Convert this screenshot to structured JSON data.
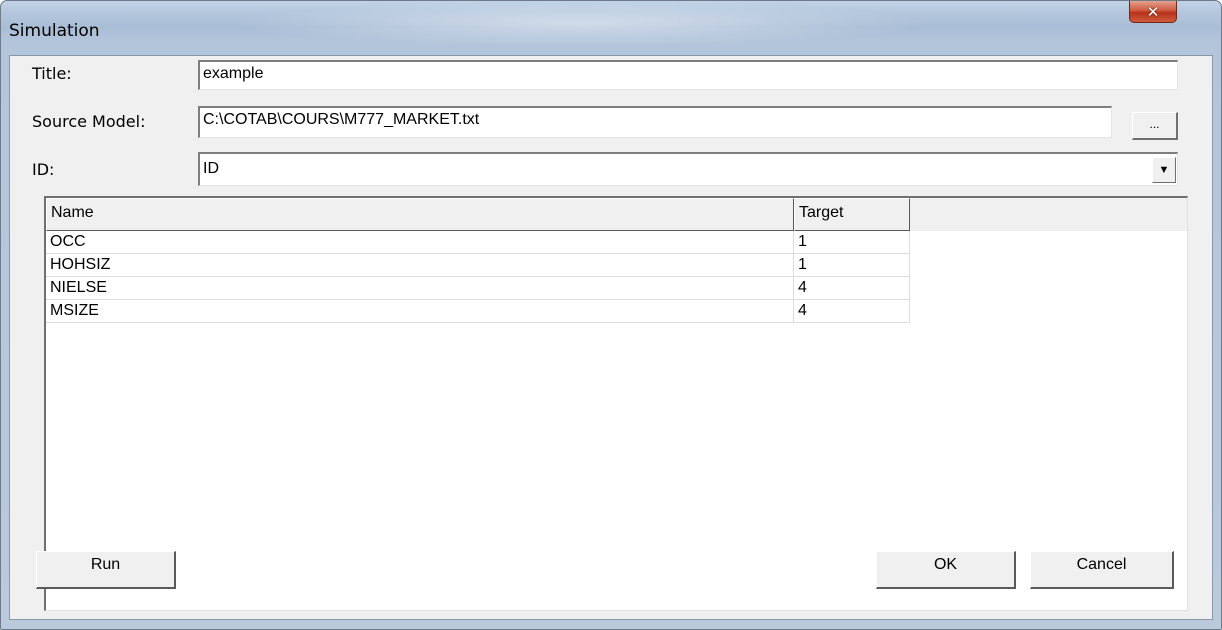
{
  "window": {
    "title": "Simulation",
    "close_glyph": "✕"
  },
  "form": {
    "title_label": "Title:",
    "title_value": "example",
    "source_label": "Source Model:",
    "source_value": "C:\\COTAB\\COURS\\M777_MARKET.txt",
    "browse_label": "...",
    "id_label": "ID:",
    "id_value": "ID",
    "dropdown_glyph": "▼"
  },
  "grid": {
    "headers": {
      "name": "Name",
      "target": "Target"
    },
    "rows": [
      {
        "name": "OCC",
        "target": "1"
      },
      {
        "name": "HOHSIZ",
        "target": "1"
      },
      {
        "name": "NIELSE",
        "target": "4"
      },
      {
        "name": "MSIZE",
        "target": "4"
      }
    ]
  },
  "buttons": {
    "run": "Run",
    "ok": "OK",
    "cancel": "Cancel"
  },
  "icons": {
    "close": "close-icon",
    "dropdown": "chevron-down-icon"
  }
}
